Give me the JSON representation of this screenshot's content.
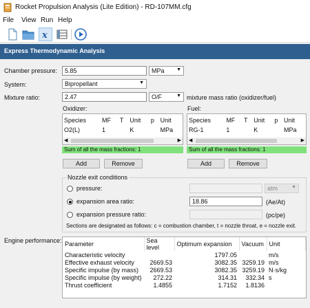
{
  "window": {
    "title": "Rocket Propulsion Analysis (Lite Edition) - RD-107MM.cfg"
  },
  "menu": [
    "File",
    "View",
    "Run",
    "Help"
  ],
  "toolbar": {
    "icons": [
      "new-file-icon",
      "open-folder-icon",
      "formula-icon",
      "table-icon",
      "run-icon"
    ]
  },
  "header": "Express Thermodynamic Analysis",
  "form": {
    "chamber_pressure_label": "Chamber pressure:",
    "chamber_pressure_value": "5.85",
    "chamber_pressure_unit": "MPa",
    "system_label": "System:",
    "system_value": "Bipropellant",
    "mixture_label": "Mixture ratio:",
    "mixture_value": "2.47",
    "mixture_unit": "O/F",
    "mixture_desc": "mixture mass ratio (oxidizer/fuel)"
  },
  "oxidizer": {
    "label": "Oxidizer:",
    "columns": [
      "Species",
      "MF",
      "T",
      "Unit",
      "p",
      "Unit"
    ],
    "rows": [
      [
        "O2(L)",
        "1",
        "",
        "K",
        "",
        "MPa"
      ]
    ],
    "status": "Sum of all the mass fractions: 1",
    "add": "Add",
    "remove": "Remove"
  },
  "fuel": {
    "label": "Fuel:",
    "columns": [
      "Species",
      "MF",
      "T",
      "Unit",
      "p",
      "Unit"
    ],
    "rows": [
      [
        "RG-1",
        "1",
        "",
        "K",
        "",
        "MPa"
      ]
    ],
    "status": "Sum of all the mass fractions: 1",
    "add": "Add",
    "remove": "Remove"
  },
  "nozzle": {
    "title": "Nozzle exit conditions",
    "pressure_label": "pressure:",
    "pressure_unit": "atm",
    "area_label": "expansion area ratio:",
    "area_value": "18.86",
    "area_suffix": "(Ae/At)",
    "pratio_label": "expansion pressure ratio:",
    "pratio_suffix": "(pc/pe)",
    "note": "Sections are designated as follows: c = combustion chamber, t = nozzle throat, e = nozzle exit.",
    "selected": "area"
  },
  "performance": {
    "label": "Engine performance:",
    "columns": [
      "Parameter",
      "Sea level",
      "Optimum expansion",
      "Vacuum",
      "Unit"
    ],
    "rows": [
      [
        "Characteristic velocity",
        "",
        "1797.05",
        "",
        "m/s"
      ],
      [
        "Effective exhaust velocity",
        "2669.53",
        "3082.35",
        "3259.19",
        "m/s"
      ],
      [
        "Specific impulse (by mass)",
        "2669.53",
        "3082.35",
        "3259.19",
        "N·s/kg"
      ],
      [
        "Specific impulse (by weight)",
        "272.22",
        "314.31",
        "332.34",
        "s"
      ],
      [
        "Thrust coefficient",
        "1.4855",
        "1.7152",
        "1.8136",
        ""
      ]
    ]
  }
}
